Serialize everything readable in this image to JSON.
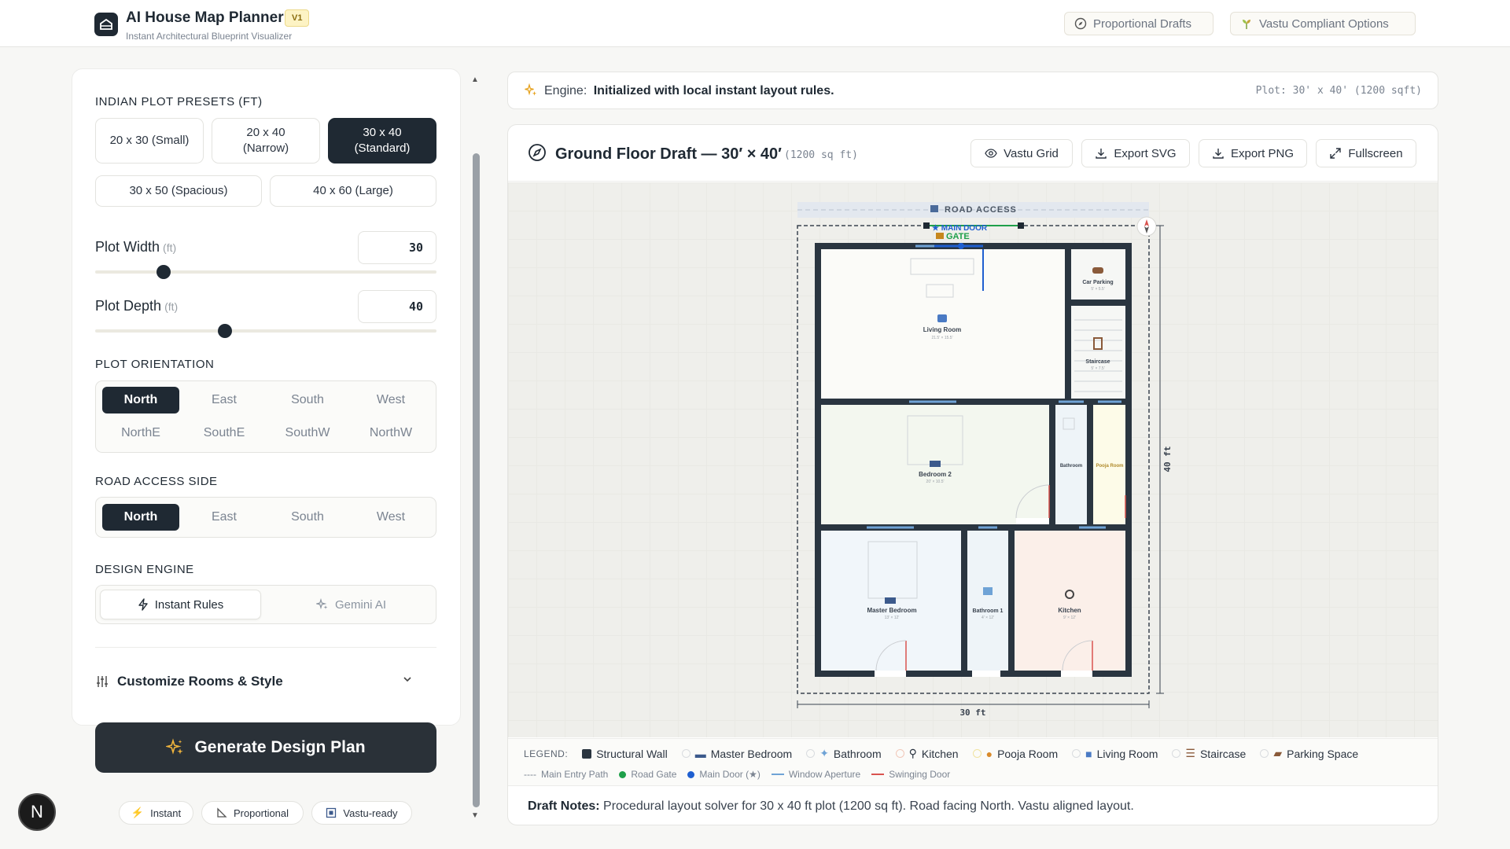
{
  "header": {
    "title": "AI House Map Planner",
    "version": "V1",
    "subtitle": "Instant Architectural Blueprint Visualizer",
    "pill_proportional": "Proportional Drafts",
    "pill_vastu": "Vastu Compliant Options"
  },
  "sidebar": {
    "presets_label": "INDIAN PLOT PRESETS (FT)",
    "presets": [
      {
        "line1": "20 x 30 (Small)",
        "line2": ""
      },
      {
        "line1": "20 x 40",
        "line2": "(Narrow)"
      },
      {
        "line1": "30 x 40",
        "line2": "(Standard)"
      },
      {
        "line1": "30 x 50 (Spacious)",
        "line2": ""
      },
      {
        "line1": "40 x 60 (Large)",
        "line2": ""
      }
    ],
    "active_preset": "30 x 40",
    "plot_width_label": "Plot Width",
    "plot_width_unit": "(ft)",
    "plot_width_value": "30",
    "plot_width_fraction": 0.2,
    "plot_depth_label": "Plot Depth",
    "plot_depth_unit": "(ft)",
    "plot_depth_value": "40",
    "plot_depth_fraction": 0.38,
    "orientation_label": "PLOT ORIENTATION",
    "orientation_options": [
      "North",
      "East",
      "South",
      "West",
      "NorthE",
      "SouthE",
      "SouthW",
      "NorthW"
    ],
    "orientation_selected": "North",
    "road_label": "ROAD ACCESS SIDE",
    "road_options": [
      "North",
      "East",
      "South",
      "West"
    ],
    "road_selected": "North",
    "engine_label": "DESIGN ENGINE",
    "engine_instant": "Instant Rules",
    "engine_gemini": "Gemini AI",
    "customize_label": "Customize Rooms & Style",
    "generate_label": "Generate Design Plan",
    "pill_instant": "Instant",
    "pill_proportional": "Proportional",
    "pill_vastu": "Vastu-ready"
  },
  "engine_bar": {
    "label": "Engine:",
    "status": "Initialized with local instant layout rules.",
    "plot": "Plot: 30' x 40' (1200 sqft)"
  },
  "draft": {
    "title": "Ground Floor Draft — 30′ × 40′",
    "area": "(1200 sq ft)",
    "btn_vastu": "Vastu Grid",
    "btn_svg": "Export SVG",
    "btn_png": "Export PNG",
    "btn_fullscreen": "Fullscreen"
  },
  "plan": {
    "road_access": "ROAD ACCESS",
    "main_door": "★ MAIN DOOR",
    "gate": "GATE",
    "width_label": "30 ft",
    "depth_label": "40 ft",
    "rooms": {
      "living": {
        "name": "Living Room",
        "size": "21.5' × 15.5'"
      },
      "car": {
        "name": "Car Parking",
        "size": "5' × 5.5'"
      },
      "stair": {
        "name": "Staircase",
        "size": "5' × 7.5'"
      },
      "bed2": {
        "name": "Bedroom 2",
        "size": "20' × 10.5'"
      },
      "bath": {
        "name": "Bathroom",
        "size": ""
      },
      "pooja": {
        "name": "Pooja Room",
        "size": ""
      },
      "master": {
        "name": "Master Bedroom",
        "size": "13' × 12'"
      },
      "bath1": {
        "name": "Bathroom 1",
        "size": "4' × 12'"
      },
      "kitchen": {
        "name": "Kitchen",
        "size": "9' × 12'"
      }
    },
    "colors": {
      "wall": "#2a3540",
      "living": "#fbfbf8",
      "bed2": "#f3f7ef",
      "master": "#f1f6fa",
      "bath": "#eef4f8",
      "pooja": "#fdfbe8",
      "kitchen": "#fbefe9"
    }
  },
  "legend": {
    "label": "LEGEND:",
    "items": [
      "Structural Wall",
      "Master Bedroom",
      "Bathroom",
      "Kitchen",
      "Pooja Room",
      "Living Room",
      "Staircase",
      "Parking Space"
    ],
    "row2": [
      "Main Entry Path",
      "Road Gate",
      "Main Door (★)",
      "Window Aperture",
      "Swinging Door"
    ]
  },
  "notes": {
    "label": "Draft Notes:",
    "text": "Procedural layout solver for 30 x 40 ft plot (1200 sq ft). Road facing North. Vastu aligned layout."
  }
}
